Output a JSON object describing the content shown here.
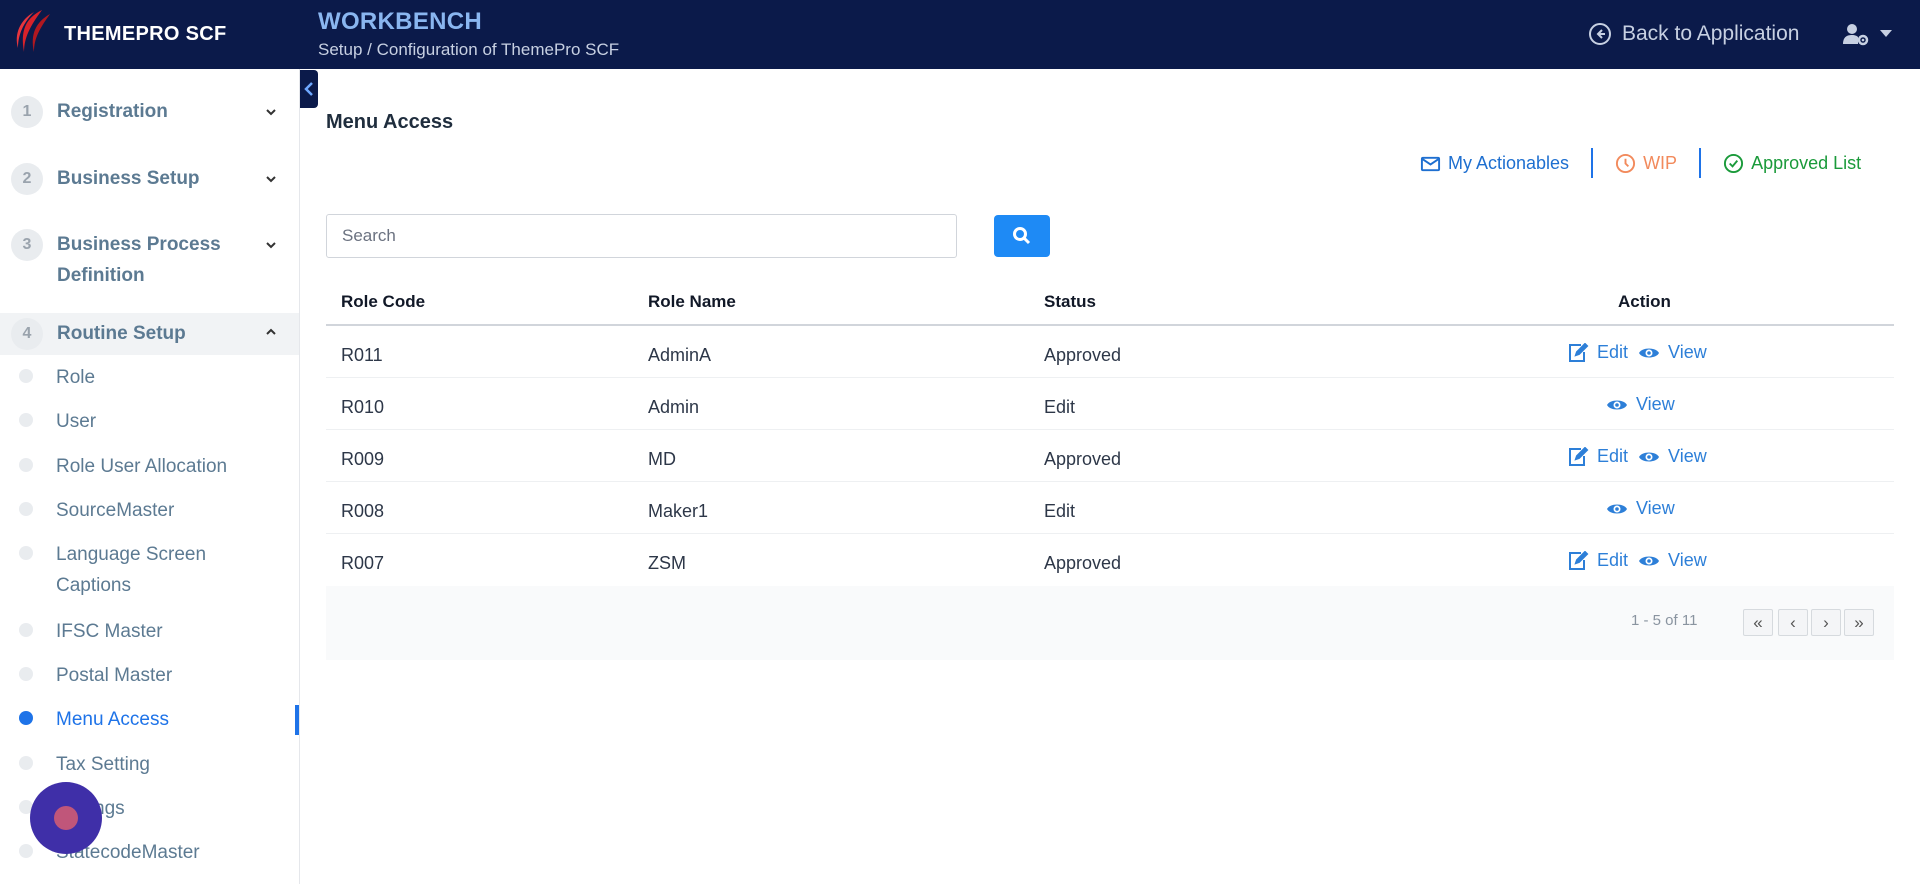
{
  "brand": {
    "name": "THEMEPRO SCF"
  },
  "header": {
    "title": "WORKBENCH",
    "breadcrumb": "Setup / Configuration of ThemePro SCF",
    "back_label": "Back to Application"
  },
  "sidebar": {
    "sections": [
      {
        "num": "1",
        "label": "Registration"
      },
      {
        "num": "2",
        "label": "Business Setup"
      },
      {
        "num": "3",
        "label": "Business Process Definition"
      },
      {
        "num": "4",
        "label": "Routine Setup"
      }
    ],
    "items": [
      {
        "label": "Role"
      },
      {
        "label": "User"
      },
      {
        "label": "Role User Allocation"
      },
      {
        "label": "SourceMaster"
      },
      {
        "label": "Language Screen Captions"
      },
      {
        "label": "IFSC Master"
      },
      {
        "label": "Postal Master"
      },
      {
        "label": "Menu Access"
      },
      {
        "label": "Tax Setting"
      },
      {
        "label": "Settings"
      },
      {
        "label": "StatecodeMaster"
      }
    ],
    "active_item": "Menu Access"
  },
  "main": {
    "title": "Menu Access",
    "filters": {
      "actionables": "My Actionables",
      "wip": "WIP",
      "approved": "Approved List"
    },
    "search": {
      "placeholder": "Search",
      "value": ""
    },
    "table": {
      "columns": [
        "Role Code",
        "Role Name",
        "Status",
        "Action"
      ],
      "rows": [
        {
          "code": "R011",
          "name": "AdminA",
          "status": "Approved",
          "edit": "Edit",
          "view": "View"
        },
        {
          "code": "R010",
          "name": "Admin",
          "status": "Edit",
          "view": "View"
        },
        {
          "code": "R009",
          "name": "MD",
          "status": "Approved",
          "edit": "Edit",
          "view": "View"
        },
        {
          "code": "R008",
          "name": "Maker1",
          "status": "Edit",
          "view": "View"
        },
        {
          "code": "R007",
          "name": "ZSM",
          "status": "Approved",
          "edit": "Edit",
          "view": "View"
        }
      ]
    },
    "pagination": {
      "range": "1 - 5 of 11",
      "first": "«",
      "prev": "‹",
      "next": "›",
      "last": "»"
    }
  },
  "colors": {
    "header_bg": "#0b1a4a",
    "accent": "#1e73e8",
    "wip": "#f28a5c",
    "approved": "#1a9a3a"
  }
}
